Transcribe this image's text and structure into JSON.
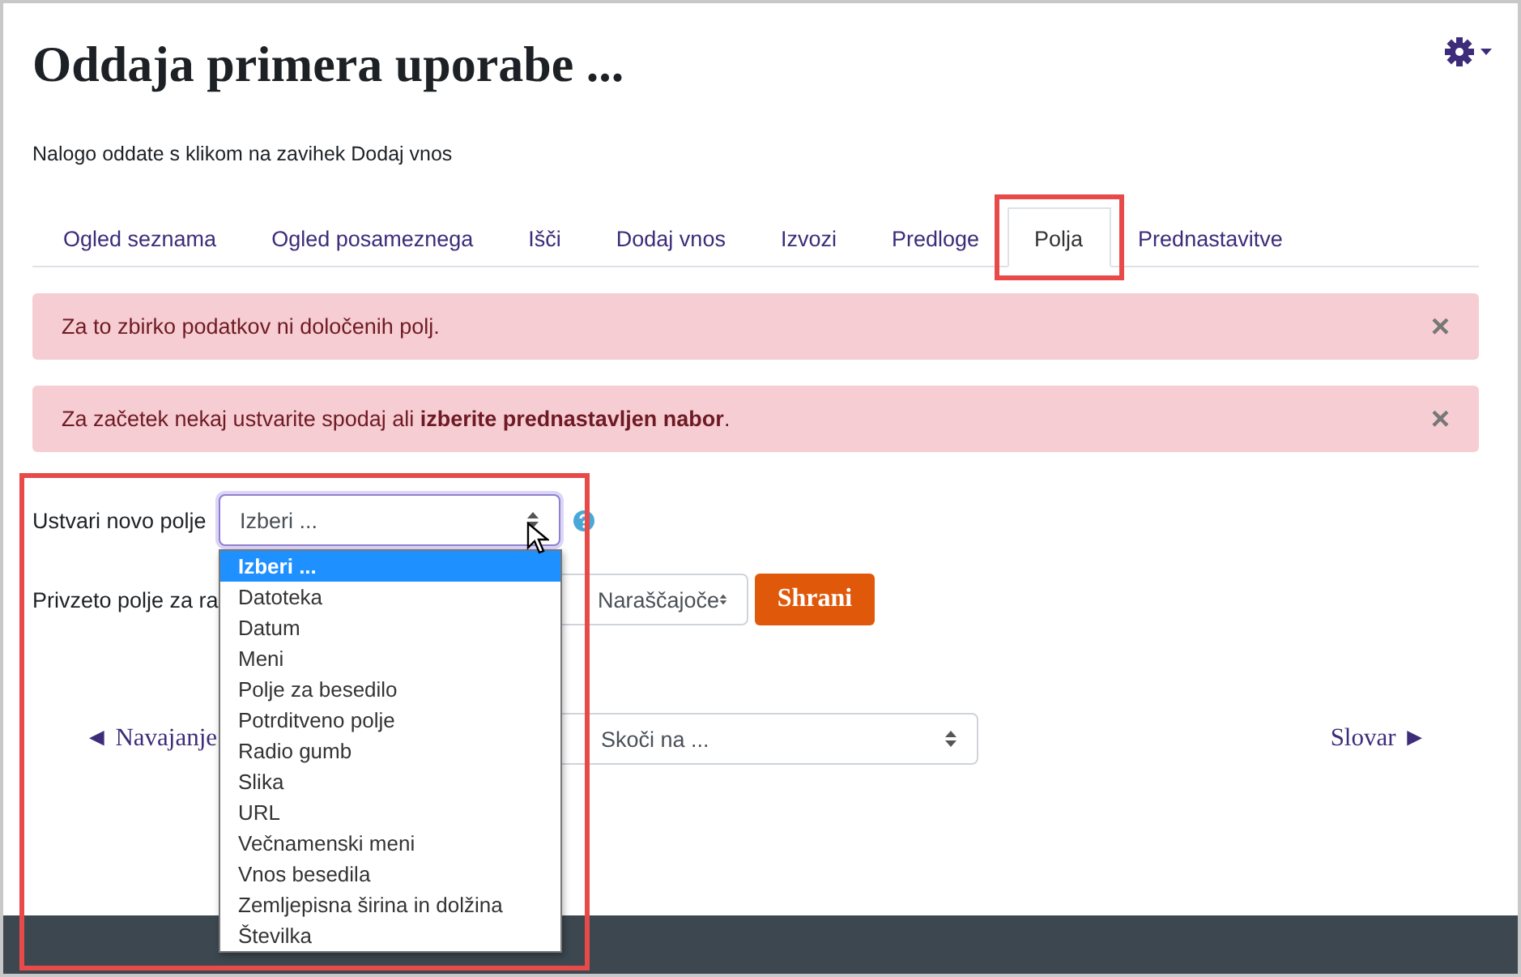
{
  "title": "Oddaja primera uporabe ...",
  "description": "Nalogo oddate s klikom na zavihek Dodaj vnos",
  "tabs": [
    {
      "label": "Ogled seznama",
      "selected": false,
      "highlighted": false
    },
    {
      "label": "Ogled posameznega",
      "selected": false,
      "highlighted": false
    },
    {
      "label": "Išči",
      "selected": false,
      "highlighted": false
    },
    {
      "label": "Dodaj vnos",
      "selected": false,
      "highlighted": false
    },
    {
      "label": "Izvozi",
      "selected": false,
      "highlighted": false
    },
    {
      "label": "Predloge",
      "selected": false,
      "highlighted": false
    },
    {
      "label": "Polja",
      "selected": true,
      "highlighted": true
    },
    {
      "label": "Prednastavitve",
      "selected": false,
      "highlighted": false
    }
  ],
  "alerts": [
    {
      "text": "Za to zbirko podatkov ni določenih polj.",
      "close": "×"
    },
    {
      "text": "Za začetek nekaj ustvarite spodaj ali **izberite prednastavljen nabor**.",
      "close": "×"
    }
  ],
  "form": {
    "highlighted": true,
    "new_field": {
      "label": "Ustvari novo polje",
      "value": "Izberi ...",
      "expanded": true,
      "options": [
        {
          "label": "Izberi ...",
          "selected": true
        },
        {
          "label": "Datoteka",
          "selected": false
        },
        {
          "label": "Datum",
          "selected": false
        },
        {
          "label": "Meni",
          "selected": false
        },
        {
          "label": "Polje za besedilo",
          "selected": false
        },
        {
          "label": "Potrditveno polje",
          "selected": false
        },
        {
          "label": "Radio gumb",
          "selected": false
        },
        {
          "label": "Slika",
          "selected": false
        },
        {
          "label": "URL",
          "selected": false
        },
        {
          "label": "Večnamenski meni",
          "selected": false
        },
        {
          "label": "Vnos besedila",
          "selected": false
        },
        {
          "label": "Zemljepisna širina in dolžina",
          "selected": false
        },
        {
          "label": "Številka",
          "selected": false
        }
      ]
    },
    "sort": {
      "label": "Privzeto polje za ra",
      "order": "Naraščajoče",
      "save": "Shrani"
    }
  },
  "nav": {
    "previous": "◄ Navajanje",
    "jump": "Skoči na ...",
    "next": "Slovar ►"
  }
}
